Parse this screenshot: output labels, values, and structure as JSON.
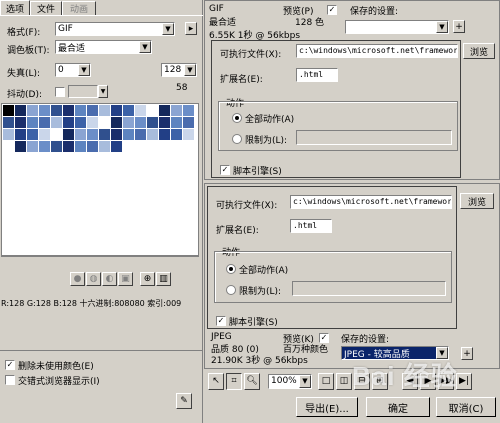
{
  "tabs": [
    "选项",
    "文件",
    "动画"
  ],
  "left": {
    "format_label": "格式(F):",
    "format_value": "GIF",
    "palette_label": "调色板(T):",
    "palette_value": "最合适",
    "loss_label": "失真(L):",
    "loss_value": "0",
    "colors_value": "128",
    "colors_count": "58",
    "dither_label": "抖动(D):",
    "color_info": "R:128 G:128 B:128 十六进制:808080 索引:009",
    "remove_unused_label": "删除未使用颜色(E)",
    "interlaced_label": "交错式浏览器显示(I)",
    "swatch_colors": [
      "#ffffff",
      "#1a2e6c",
      "#4a6cae",
      "#223f86",
      "#8aa4d2",
      "#30508e",
      "#5d84c0",
      "#cad6ea",
      "#14285c",
      "#6b8ec8",
      "#a8bcdc",
      "#3c62a8"
    ]
  },
  "top_pane": {
    "format": "GIF",
    "preview_label": "预览(P)",
    "saved_settings_label": "保存的设置:",
    "palette": "最合适",
    "colors": "128 色",
    "size_time": "6.55K 1秒 @ 56kbps",
    "exe_label": "可执行文件(X):",
    "exe_path": "c:\\windows\\microsoft.net\\framework\\v",
    "browse_label": "浏览",
    "ext_label": "扩展名(E):",
    "ext_value": ".html",
    "action_legend": "动作",
    "all_actions_label": "全部动作(A)",
    "limit_label": "限制为(L):",
    "script_engine_label": "脚本引擎(S)"
  },
  "bottom_pane": {
    "exe_label": "可执行文件(X):",
    "exe_path": "c:\\windows\\microsoft.net\\framework\\v",
    "browse_label": "浏览",
    "ext_label": "扩展名(E):",
    "ext_value": ".html",
    "action_legend": "动作",
    "all_actions_label": "全部动作(A)",
    "limit_label": "限制为(L):",
    "script_engine_label": "脚本引擎(S)",
    "format": "JPEG",
    "quality": "品质 80 (0)",
    "size_time": "21.90K 3秒 @ 56kbps",
    "preview_label": "预览(K)",
    "colors": "百万种颜色",
    "saved_settings_label": "保存的设置:",
    "saved_settings_value": "JPEG - 较高品质"
  },
  "toolbar": {
    "zoom": "100%"
  },
  "buttons": {
    "export": "导出(E)...",
    "ok": "确定",
    "cancel": "取消(C)"
  },
  "watermark": "Bai 经验"
}
